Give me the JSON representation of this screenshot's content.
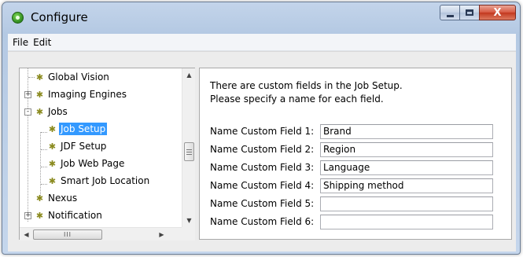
{
  "window": {
    "title": "Configure",
    "close_glyph": "X"
  },
  "menubar": {
    "items": [
      "File",
      "Edit"
    ]
  },
  "tree": {
    "items": [
      {
        "label": "Global Vision",
        "icon": "gear-icon"
      },
      {
        "label": "Imaging Engines",
        "icon": "gear-icon",
        "expander": "+"
      },
      {
        "label": "Jobs",
        "icon": "gear-icon",
        "expander": "-"
      },
      {
        "label": "Job Setup",
        "icon": "gear-icon",
        "selected": true
      },
      {
        "label": "JDF Setup",
        "icon": "gear-icon"
      },
      {
        "label": "Job Web Page",
        "icon": "gear-icon"
      },
      {
        "label": "Smart Job Location",
        "icon": "gear-icon"
      },
      {
        "label": "Nexus",
        "icon": "gear-icon",
        "expander": "+"
      },
      {
        "label": "Notification",
        "icon": "gear-icon",
        "expander": "+"
      }
    ],
    "hscroll_thumb_glyph": "III"
  },
  "content": {
    "info_line1": "There are custom fields in the Job Setup.",
    "info_line2": "Please specify a name for each field.",
    "fields": [
      {
        "label": "Name Custom Field 1:",
        "value": "Brand"
      },
      {
        "label": "Name Custom Field 2:",
        "value": "Region"
      },
      {
        "label": "Name Custom Field 3:",
        "value": "Language"
      },
      {
        "label": "Name Custom Field 4:",
        "value": "Shipping method"
      },
      {
        "label": "Name Custom Field 5:",
        "value": ""
      },
      {
        "label": "Name Custom Field 6:",
        "value": ""
      }
    ]
  },
  "colors": {
    "selection": "#3399ff",
    "titlebar": "#b4c9e3",
    "close_button": "#c2381f"
  }
}
